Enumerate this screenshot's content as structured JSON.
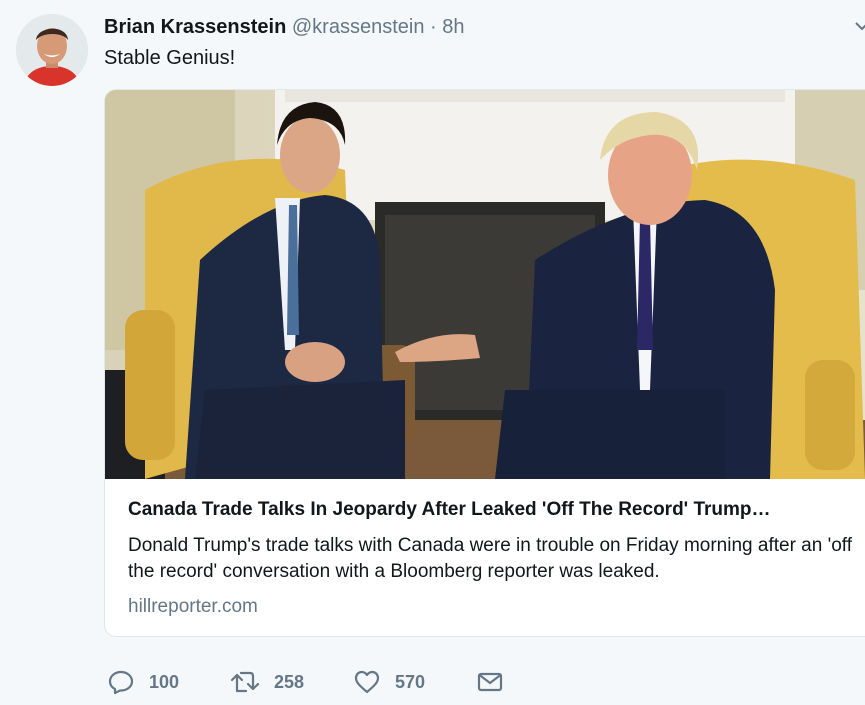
{
  "tweet": {
    "author": {
      "name": "Brian Krassenstein",
      "handle": "@krassenstein",
      "separator": "·",
      "time": "8h"
    },
    "text": "Stable Genius!",
    "card": {
      "title": "Canada Trade Talks In Jeopardy After Leaked 'Off The Record' Trump…",
      "description": "Donald Trump's trade talks with Canada were in trouble on Friday morning after an 'off the record' conversation with a Bloomberg reporter was leaked.",
      "domain": "hillreporter.com"
    },
    "actions": {
      "reply_count": "100",
      "retweet_count": "258",
      "like_count": "570"
    },
    "icons": {
      "reply": "reply-icon",
      "retweet": "retweet-icon",
      "like": "heart-icon",
      "message": "envelope-icon",
      "menu": "chevron-down-icon"
    },
    "colors": {
      "background": "#f5f8fa",
      "text": "#14171a",
      "secondary": "#657786",
      "border": "#e1e8ed"
    }
  }
}
